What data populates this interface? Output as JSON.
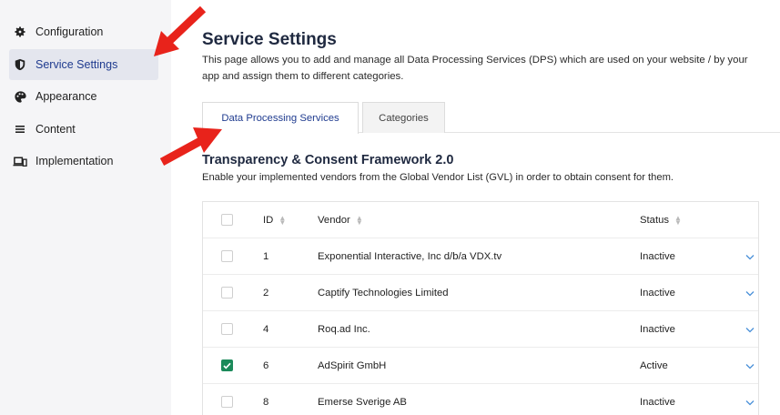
{
  "sidebar": {
    "items": [
      {
        "label": "Configuration",
        "icon": "gear-icon",
        "active": false
      },
      {
        "label": "Service Settings",
        "icon": "shield-icon",
        "active": true
      },
      {
        "label": "Appearance",
        "icon": "palette-icon",
        "active": false
      },
      {
        "label": "Content",
        "icon": "content-lines-icon",
        "active": false
      },
      {
        "label": "Implementation",
        "icon": "devices-icon",
        "active": false
      }
    ]
  },
  "header": {
    "title": "Service Settings",
    "description": "This page allows you to add and manage all Data Processing Services (DPS) which are used on your website / by your app and assign them to different categories."
  },
  "tabs": [
    {
      "label": "Data Processing Services",
      "active": true
    },
    {
      "label": "Categories",
      "active": false
    }
  ],
  "section": {
    "title": "Transparency & Consent Framework 2.0",
    "description": "Enable your implemented vendors from the Global Vendor List (GVL) in order to obtain consent for them."
  },
  "table": {
    "columns": {
      "id": "ID",
      "vendor": "Vendor",
      "status": "Status"
    },
    "rows": [
      {
        "id": "1",
        "vendor": "Exponential Interactive, Inc d/b/a VDX.tv",
        "status": "Inactive",
        "checked": false
      },
      {
        "id": "2",
        "vendor": "Captify Technologies Limited",
        "status": "Inactive",
        "checked": false
      },
      {
        "id": "4",
        "vendor": "Roq.ad Inc.",
        "status": "Inactive",
        "checked": false
      },
      {
        "id": "6",
        "vendor": "AdSpirit GmbH",
        "status": "Active",
        "checked": true
      },
      {
        "id": "8",
        "vendor": "Emerse Sverige AB",
        "status": "Inactive",
        "checked": false
      }
    ]
  },
  "colors": {
    "accent": "#1f3b8f",
    "checked": "#1b8a5a",
    "annotation_arrow": "#e8231b",
    "chevron": "#4a90d9"
  }
}
